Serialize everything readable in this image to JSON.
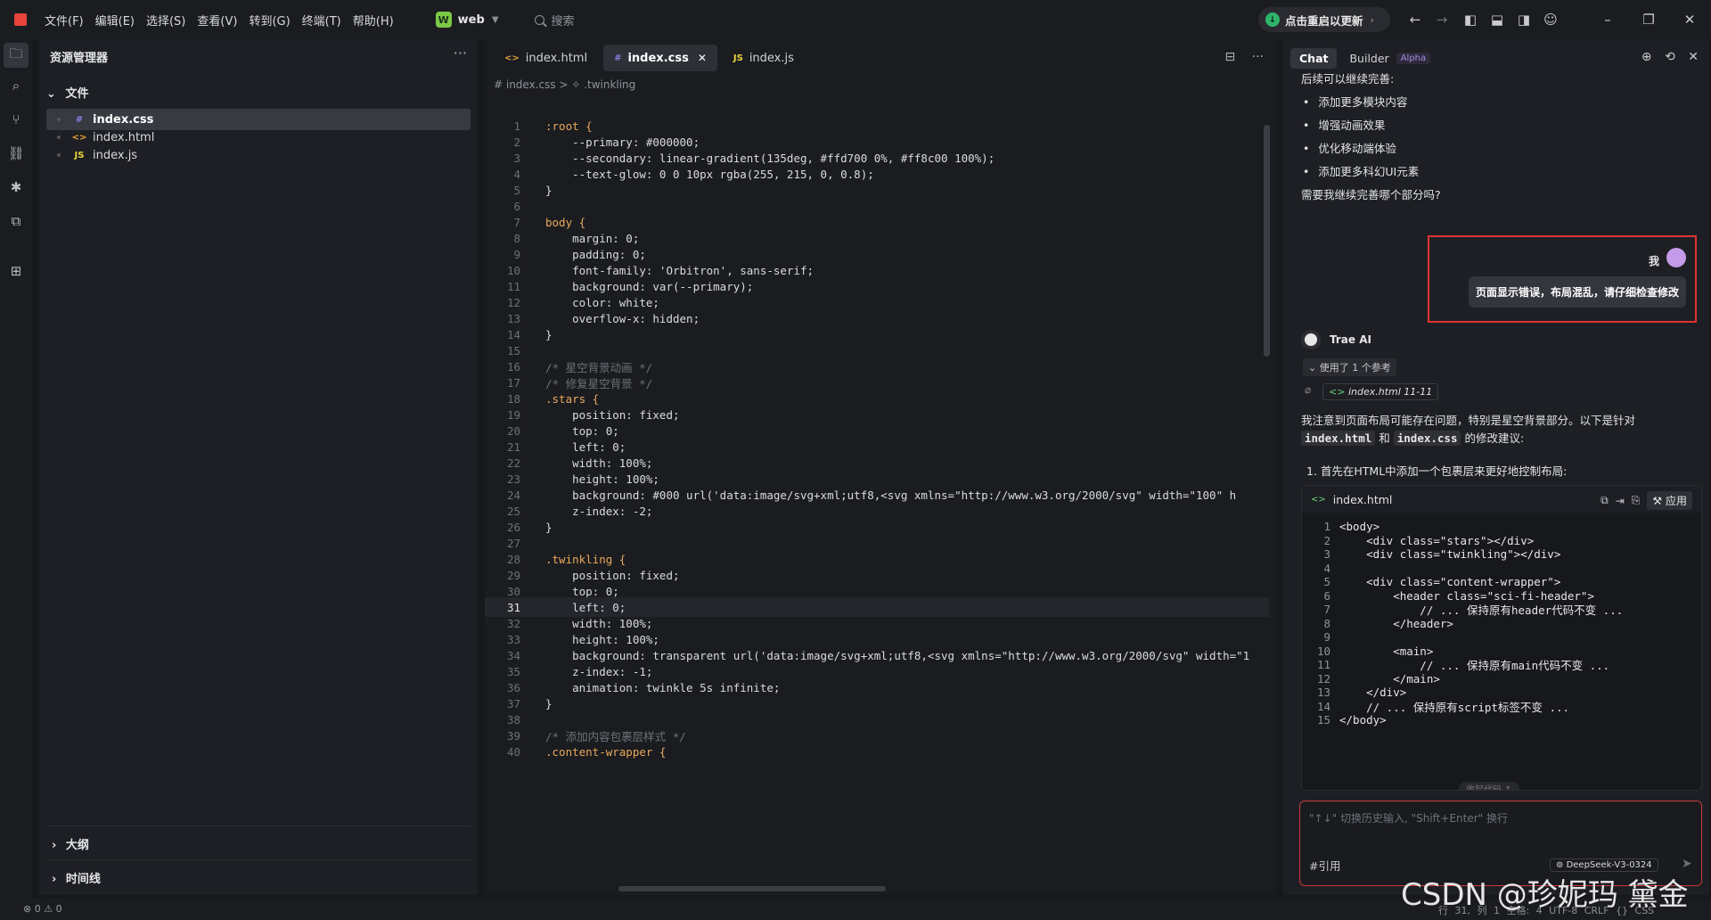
{
  "menu": [
    "文件(F)",
    "编辑(E)",
    "选择(S)",
    "查看(V)",
    "转到(G)",
    "终端(T)",
    "帮助(H)"
  ],
  "workspace": {
    "badge": "W",
    "name": "web"
  },
  "search_placeholder": "搜索",
  "update_label": "点击重启以更新",
  "explorer": {
    "title": "资源管理器",
    "files_header": "文件",
    "files": [
      {
        "icon": "#",
        "name": "index.css",
        "color": "#8a7de0"
      },
      {
        "icon": "<>",
        "name": "index.html",
        "color": "#e8a13a"
      },
      {
        "icon": "JS",
        "name": "index.js",
        "color": "#e8d33a"
      }
    ],
    "outline": "大纲",
    "timeline": "时间线"
  },
  "editor": {
    "tabs": [
      {
        "icon": "<>",
        "name": "index.html",
        "color": "#e8a13a"
      },
      {
        "icon": "#",
        "name": "index.css",
        "color": "#8a7de0"
      },
      {
        "icon": "JS",
        "name": "index.js",
        "color": "#e8d33a"
      }
    ],
    "breadcrumb": "# index.css > ✧ .twinkling",
    "current_line": 31,
    "lines": [
      {
        "n": "1",
        "t": ":root {"
      },
      {
        "n": "2",
        "t": "    --primary: #000000;"
      },
      {
        "n": "3",
        "t": "    --secondary: linear-gradient(135deg, #ffd700 0%, #ff8c00 100%);"
      },
      {
        "n": "4",
        "t": "    --text-glow: 0 0 10px rgba(255, 215, 0, 0.8);"
      },
      {
        "n": "5",
        "t": "}"
      },
      {
        "n": "6",
        "t": ""
      },
      {
        "n": "7",
        "t": "body {"
      },
      {
        "n": "8",
        "t": "    margin: 0;"
      },
      {
        "n": "9",
        "t": "    padding: 0;"
      },
      {
        "n": "10",
        "t": "    font-family: 'Orbitron', sans-serif;"
      },
      {
        "n": "11",
        "t": "    background: var(--primary);"
      },
      {
        "n": "12",
        "t": "    color: white;"
      },
      {
        "n": "13",
        "t": "    overflow-x: hidden;"
      },
      {
        "n": "14",
        "t": "}"
      },
      {
        "n": "15",
        "t": ""
      },
      {
        "n": "16",
        "t": "/* 星空背景动画 */"
      },
      {
        "n": "17",
        "t": "/* 修复星空背景 */"
      },
      {
        "n": "18",
        "t": ".stars {"
      },
      {
        "n": "19",
        "t": "    position: fixed;"
      },
      {
        "n": "20",
        "t": "    top: 0;"
      },
      {
        "n": "21",
        "t": "    left: 0;"
      },
      {
        "n": "22",
        "t": "    width: 100%;"
      },
      {
        "n": "23",
        "t": "    height: 100%;"
      },
      {
        "n": "24",
        "t": "    background: #000 url('data:image/svg+xml;utf8,<svg xmlns=\"http://www.w3.org/2000/svg\" width=\"100\" h"
      },
      {
        "n": "25",
        "t": "    z-index: -2;"
      },
      {
        "n": "26",
        "t": "}"
      },
      {
        "n": "27",
        "t": ""
      },
      {
        "n": "28",
        "t": ".twinkling {"
      },
      {
        "n": "29",
        "t": "    position: fixed;"
      },
      {
        "n": "30",
        "t": "    top: 0;"
      },
      {
        "n": "31",
        "t": "    left: 0;"
      },
      {
        "n": "32",
        "t": "    width: 100%;"
      },
      {
        "n": "33",
        "t": "    height: 100%;"
      },
      {
        "n": "34",
        "t": "    background: transparent url('data:image/svg+xml;utf8,<svg xmlns=\"http://www.w3.org/2000/svg\" width=\"1"
      },
      {
        "n": "35",
        "t": "    z-index: -1;"
      },
      {
        "n": "36",
        "t": "    animation: twinkle 5s infinite;"
      },
      {
        "n": "37",
        "t": "}"
      },
      {
        "n": "38",
        "t": ""
      },
      {
        "n": "39",
        "t": "/* 添加内容包裹层样式 */"
      },
      {
        "n": "40",
        "t": ".content-wrapper {"
      }
    ]
  },
  "chat": {
    "tabs": [
      "Chat",
      "Builder"
    ],
    "alpha_badge": "Alpha",
    "intro": "后续可以继续完善:",
    "bullets": [
      "添加更多模块内容",
      "增强动画效果",
      "优化移动端体验",
      "添加更多科幻UI元素"
    ],
    "followup": "需要我继续完善哪个部分吗?",
    "user_name": "我",
    "user_message": "页面显示错误，布局混乱，请仔细检查修改",
    "ai_name": "Trae AI",
    "ref_toggle": "使用了 1 个参考",
    "ref_chip": "index.html 11-11",
    "answer_a": "我注意到页面布局可能存在问题，特别是星空背景部分。以下是针对",
    "code_a": "index.html",
    "and": "和",
    "code_b": "index.css",
    "answer_b": "的修改建议:",
    "step1": "1. 首先在HTML中添加一个包裹层来更好地控制布局:",
    "card_title": "index.html",
    "apply": "应用",
    "card_lines": [
      {
        "n": "1",
        "t": "<body>"
      },
      {
        "n": "2",
        "t": "    <div class=\"stars\"></div>"
      },
      {
        "n": "3",
        "t": "    <div class=\"twinkling\"></div>"
      },
      {
        "n": "4",
        "t": ""
      },
      {
        "n": "5",
        "t": "    <div class=\"content-wrapper\">"
      },
      {
        "n": "6",
        "t": "        <header class=\"sci-fi-header\">"
      },
      {
        "n": "7",
        "t": "            // ... 保持原有header代码不变 ..."
      },
      {
        "n": "8",
        "t": "        </header>"
      },
      {
        "n": "9",
        "t": ""
      },
      {
        "n": "10",
        "t": "        <main>"
      },
      {
        "n": "11",
        "t": "            // ... 保持原有main代码不变 ..."
      },
      {
        "n": "12",
        "t": "        </main>"
      },
      {
        "n": "13",
        "t": "    </div>"
      },
      {
        "n": "14",
        "t": "    // ... 保持原有script标签不变 ..."
      },
      {
        "n": "15",
        "t": "</body>"
      }
    ],
    "collapse": "收起代码 ↑",
    "input_placeholder": "\"↑↓\" 切换历史输入, \"Shift+Enter\" 换行",
    "input_ref": "#引用",
    "model": "DeepSeek-V3-0324"
  },
  "status": {
    "left": "⊗ 0 ⚠ 0",
    "right": "行 31, 列 1   空格: 4   UTF-8   CRLF   {} CSS"
  },
  "watermark": "CSDN @珍妮玛 黛金"
}
